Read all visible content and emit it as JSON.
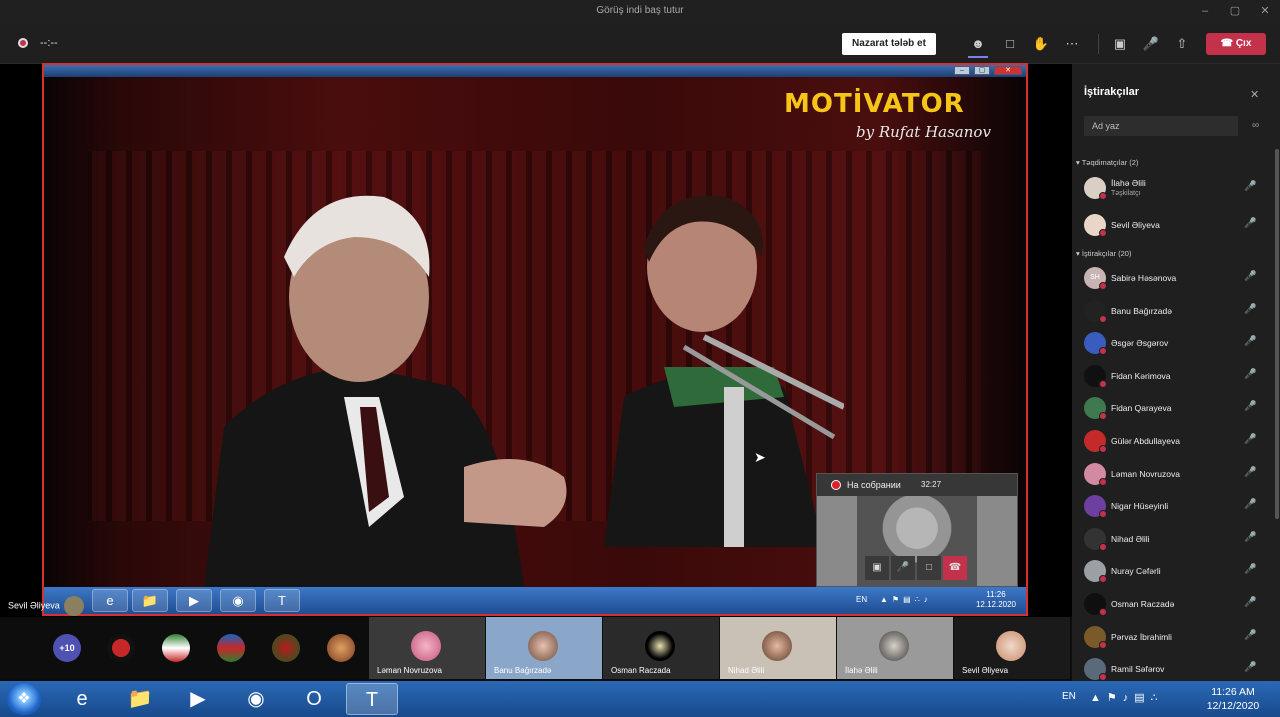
{
  "window": {
    "title": "Görüş indi baş tutur",
    "controls": [
      "–",
      "▢",
      "✕"
    ]
  },
  "toolbar": {
    "timer": "--:--",
    "request_control_label": "Nazarat tələb et",
    "leave_label": "Çıx",
    "icons": [
      "people-icon",
      "chat-icon",
      "raise-hand-icon",
      "more-icon",
      "camera-off-icon",
      "mic-off-icon",
      "share-icon"
    ]
  },
  "shared_screen": {
    "logo_text": "MOTİVATOR",
    "logo_sub": "by Rufat Hasanov",
    "pip": {
      "status": "На собрании",
      "time": "32:27"
    },
    "inner_taskbar": {
      "lang": "EN",
      "time": "11:26",
      "date": "12.12.2020"
    },
    "presenter_label": "Sevil Əliyeva"
  },
  "strip": {
    "more_count": "+10",
    "tiles": [
      {
        "name": "Ləman Novruzova"
      },
      {
        "name": "Banu Bağırzadə"
      },
      {
        "name": "Osman Raczada"
      },
      {
        "name": "Nihad Əlili"
      },
      {
        "name": "İlahə Əlili"
      },
      {
        "name": "Sevil Əliyeva"
      }
    ]
  },
  "panel": {
    "title": "İştirakçılar",
    "search_placeholder": "Ad yaz",
    "presenters_header": "Təqdimatçılar (2)",
    "attendees_header": "İştirakçılar (20)",
    "presenters": [
      {
        "name": "İlahə Əlili",
        "role": "Təşkilatçı",
        "color": "#d9cfc4"
      },
      {
        "name": "Sevil Əliyeva",
        "role": "",
        "color": "#e9d6c9"
      }
    ],
    "attendees": [
      {
        "name": "Sabirə Həsənova",
        "initials": "SH",
        "color": "#c8b4b4"
      },
      {
        "name": "Banu Bağırzadə",
        "initials": "",
        "color": "#222222"
      },
      {
        "name": "Əsgər Əsgərov",
        "initials": "",
        "color": "#3b5cbf"
      },
      {
        "name": "Fidan Kərimova",
        "initials": "",
        "color": "#101010"
      },
      {
        "name": "Fidan Qarayeva",
        "initials": "",
        "color": "#3f7a4e"
      },
      {
        "name": "Gülər Abdullayeva",
        "initials": "",
        "color": "#c42a2a"
      },
      {
        "name": "Ləman Novruzova",
        "initials": "",
        "color": "#d18aa2"
      },
      {
        "name": "Nigar Hüseyinli",
        "initials": "",
        "color": "#6d3fa0"
      },
      {
        "name": "Nihad Əlili",
        "initials": "",
        "color": "#333333"
      },
      {
        "name": "Nuray Cəfərli",
        "initials": "",
        "color": "#9aa0a6"
      },
      {
        "name": "Osman Raczadə",
        "initials": "",
        "color": "#0f0f0f"
      },
      {
        "name": "Pərvaz İbrahimli",
        "initials": "",
        "color": "#7a5a2a"
      },
      {
        "name": "Ramil Səfərov",
        "initials": "",
        "color": "#5a6a7a"
      }
    ]
  },
  "taskbar": {
    "lang": "EN",
    "time": "11:26 AM",
    "date": "12/12/2020"
  }
}
